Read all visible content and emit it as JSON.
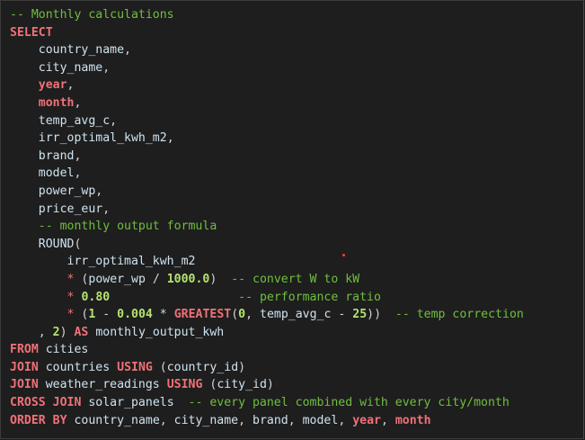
{
  "lines": [
    [
      {
        "t": "-- Monthly calculations",
        "c": "cm"
      }
    ],
    [
      {
        "t": "SELECT",
        "c": "kw"
      }
    ],
    [
      {
        "t": "    "
      },
      {
        "t": "country_name",
        "c": "id"
      },
      {
        "t": ",",
        "c": "pn"
      }
    ],
    [
      {
        "t": "    "
      },
      {
        "t": "city_name",
        "c": "id"
      },
      {
        "t": ",",
        "c": "pn"
      }
    ],
    [
      {
        "t": "    "
      },
      {
        "t": "year",
        "c": "kw"
      },
      {
        "t": ",",
        "c": "pn"
      }
    ],
    [
      {
        "t": "    "
      },
      {
        "t": "month",
        "c": "kw"
      },
      {
        "t": ",",
        "c": "pn"
      }
    ],
    [
      {
        "t": "    "
      },
      {
        "t": "temp_avg_c",
        "c": "id"
      },
      {
        "t": ",",
        "c": "pn"
      }
    ],
    [
      {
        "t": "    "
      },
      {
        "t": "irr_optimal_kwh_m2",
        "c": "id"
      },
      {
        "t": ",",
        "c": "pn"
      }
    ],
    [
      {
        "t": "    "
      },
      {
        "t": "brand",
        "c": "id"
      },
      {
        "t": ",",
        "c": "pn"
      }
    ],
    [
      {
        "t": "    "
      },
      {
        "t": "model",
        "c": "id"
      },
      {
        "t": ",",
        "c": "pn"
      }
    ],
    [
      {
        "t": "    "
      },
      {
        "t": "power_wp",
        "c": "id"
      },
      {
        "t": ",",
        "c": "pn"
      }
    ],
    [
      {
        "t": "    "
      },
      {
        "t": "price_eur",
        "c": "id"
      },
      {
        "t": ",",
        "c": "pn"
      }
    ],
    [
      {
        "t": "    "
      },
      {
        "t": "-- monthly output formula",
        "c": "cm"
      }
    ],
    [
      {
        "t": "    "
      },
      {
        "t": "ROUND",
        "c": "id"
      },
      {
        "t": "(",
        "c": "pn"
      }
    ],
    [
      {
        "t": "        "
      },
      {
        "t": "irr_optimal_kwh_m2",
        "c": "id"
      }
    ],
    [
      {
        "t": "        "
      },
      {
        "t": "*",
        "c": "op"
      },
      {
        "t": " (",
        "c": "pn"
      },
      {
        "t": "power_wp",
        "c": "id"
      },
      {
        "t": " / ",
        "c": "pn"
      },
      {
        "t": "1000.0",
        "c": "nm"
      },
      {
        "t": ")  ",
        "c": "pn"
      },
      {
        "t": "-- convert W to kW",
        "c": "cm"
      }
    ],
    [
      {
        "t": "        "
      },
      {
        "t": "*",
        "c": "op"
      },
      {
        "t": " "
      },
      {
        "t": "0.80",
        "c": "nm"
      },
      {
        "t": "                  "
      },
      {
        "t": "-- performance ratio",
        "c": "cm"
      }
    ],
    [
      {
        "t": "        "
      },
      {
        "t": "*",
        "c": "op"
      },
      {
        "t": " (",
        "c": "pn"
      },
      {
        "t": "1",
        "c": "nm"
      },
      {
        "t": " - ",
        "c": "pn"
      },
      {
        "t": "0.004",
        "c": "nm"
      },
      {
        "t": " * ",
        "c": "pn"
      },
      {
        "t": "GREATEST",
        "c": "kw"
      },
      {
        "t": "(",
        "c": "pn"
      },
      {
        "t": "0",
        "c": "nm"
      },
      {
        "t": ", ",
        "c": "pn"
      },
      {
        "t": "temp_avg_c",
        "c": "id"
      },
      {
        "t": " - ",
        "c": "pn"
      },
      {
        "t": "25",
        "c": "nm"
      },
      {
        "t": "))  ",
        "c": "pn"
      },
      {
        "t": "-- temp correction",
        "c": "cm"
      }
    ],
    [
      {
        "t": "    , ",
        "c": "pn"
      },
      {
        "t": "2",
        "c": "nm"
      },
      {
        "t": ") ",
        "c": "pn"
      },
      {
        "t": "AS",
        "c": "kw"
      },
      {
        "t": " "
      },
      {
        "t": "monthly_output_kwh",
        "c": "id"
      }
    ],
    [
      {
        "t": "FROM",
        "c": "kw"
      },
      {
        "t": " "
      },
      {
        "t": "cities",
        "c": "id"
      }
    ],
    [
      {
        "t": "JOIN",
        "c": "kw"
      },
      {
        "t": " "
      },
      {
        "t": "countries",
        "c": "id"
      },
      {
        "t": " "
      },
      {
        "t": "USING",
        "c": "kw"
      },
      {
        "t": " (",
        "c": "pn"
      },
      {
        "t": "country_id",
        "c": "id"
      },
      {
        "t": ")",
        "c": "pn"
      }
    ],
    [
      {
        "t": "JOIN",
        "c": "kw"
      },
      {
        "t": " "
      },
      {
        "t": "weather_readings",
        "c": "id"
      },
      {
        "t": " "
      },
      {
        "t": "USING",
        "c": "kw"
      },
      {
        "t": " (",
        "c": "pn"
      },
      {
        "t": "city_id",
        "c": "id"
      },
      {
        "t": ")",
        "c": "pn"
      }
    ],
    [
      {
        "t": "CROSS JOIN",
        "c": "kw"
      },
      {
        "t": " "
      },
      {
        "t": "solar_panels",
        "c": "id"
      },
      {
        "t": "  "
      },
      {
        "t": "-- every panel combined with every city/month",
        "c": "cm"
      }
    ],
    [
      {
        "t": "ORDER BY",
        "c": "kw"
      },
      {
        "t": " "
      },
      {
        "t": "country_name",
        "c": "id"
      },
      {
        "t": ", ",
        "c": "pn"
      },
      {
        "t": "city_name",
        "c": "id"
      },
      {
        "t": ", ",
        "c": "pn"
      },
      {
        "t": "brand",
        "c": "id"
      },
      {
        "t": ", ",
        "c": "pn"
      },
      {
        "t": "model",
        "c": "id"
      },
      {
        "t": ", ",
        "c": "pn"
      },
      {
        "t": "year",
        "c": "kw"
      },
      {
        "t": ", ",
        "c": "pn"
      },
      {
        "t": "month",
        "c": "kw"
      }
    ]
  ]
}
